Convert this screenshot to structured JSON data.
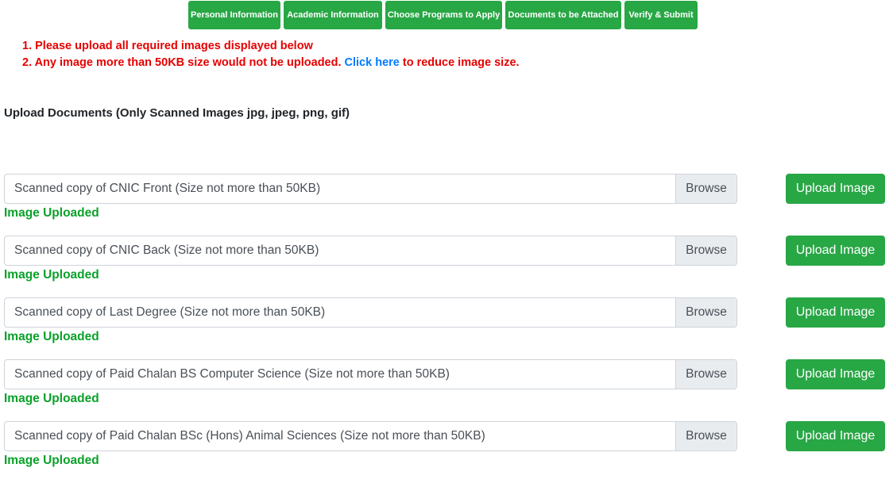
{
  "steps": [
    {
      "label": "Personal Information"
    },
    {
      "label": "Academic Information"
    },
    {
      "label": "Choose Programs to Apply"
    },
    {
      "label": "Documents to be Attached"
    },
    {
      "label": "Verify & Submit"
    }
  ],
  "notices": {
    "line1": "1. Please upload all required images displayed below",
    "line2_before": "2. Any image more than 50KB size would not be uploaded.",
    "line2_link": "Click here",
    "line2_after": "to reduce image size."
  },
  "section_heading": "Upload Documents (Only Scanned Images jpg, jpeg, png, gif)",
  "uploads": [
    {
      "label": "Scanned copy of CNIC Front (Size not more than 50KB)",
      "browse": "Browse",
      "button": "Upload Image",
      "status": "Image Uploaded"
    },
    {
      "label": "Scanned copy of CNIC Back (Size not more than 50KB)",
      "browse": "Browse",
      "button": "Upload Image",
      "status": "Image Uploaded"
    },
    {
      "label": "Scanned copy of Last Degree (Size not more than 50KB)",
      "browse": "Browse",
      "button": "Upload Image",
      "status": "Image Uploaded"
    },
    {
      "label": "Scanned copy of Paid Chalan BS Computer Science (Size not more than 50KB)",
      "browse": "Browse",
      "button": "Upload Image",
      "status": "Image Uploaded"
    },
    {
      "label": "Scanned copy of Paid Chalan BSc (Hons) Animal Sciences (Size not more than 50KB)",
      "browse": "Browse",
      "button": "Upload Image",
      "status": "Image Uploaded"
    }
  ],
  "colors": {
    "primary_green": "#28a745",
    "status_green": "#0aa12a",
    "notice_red": "#e60000",
    "link_blue": "#007bff"
  }
}
